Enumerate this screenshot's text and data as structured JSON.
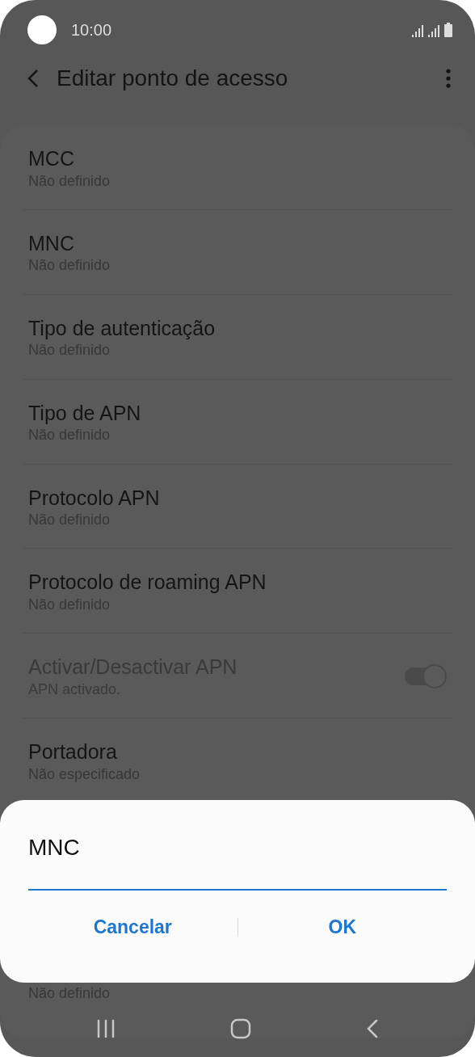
{
  "status_bar": {
    "time": "10:00"
  },
  "app_bar": {
    "title": "Editar ponto de acesso"
  },
  "settings": [
    {
      "kind": "text",
      "title": "MCC",
      "value": "Não definido",
      "disabled": false
    },
    {
      "kind": "text",
      "title": "MNC",
      "value": "Não definido",
      "disabled": false
    },
    {
      "kind": "text",
      "title": "Tipo de autenticação",
      "value": "Não definido",
      "disabled": false
    },
    {
      "kind": "text",
      "title": "Tipo de APN",
      "value": "Não definido",
      "disabled": false
    },
    {
      "kind": "text",
      "title": "Protocolo APN",
      "value": "Não definido",
      "disabled": false
    },
    {
      "kind": "text",
      "title": "Protocolo de roaming APN",
      "value": "Não definido",
      "disabled": false
    },
    {
      "kind": "toggle",
      "title": "Activar/Desactivar APN",
      "value": "APN activado.",
      "disabled": true,
      "on": true
    },
    {
      "kind": "text",
      "title": "Portadora",
      "value": "Não especificado",
      "disabled": false
    },
    {
      "kind": "covered",
      "value": "Não definido"
    }
  ],
  "dialog": {
    "title": "MNC",
    "buttons": [
      "Cancelar",
      "OK"
    ]
  }
}
